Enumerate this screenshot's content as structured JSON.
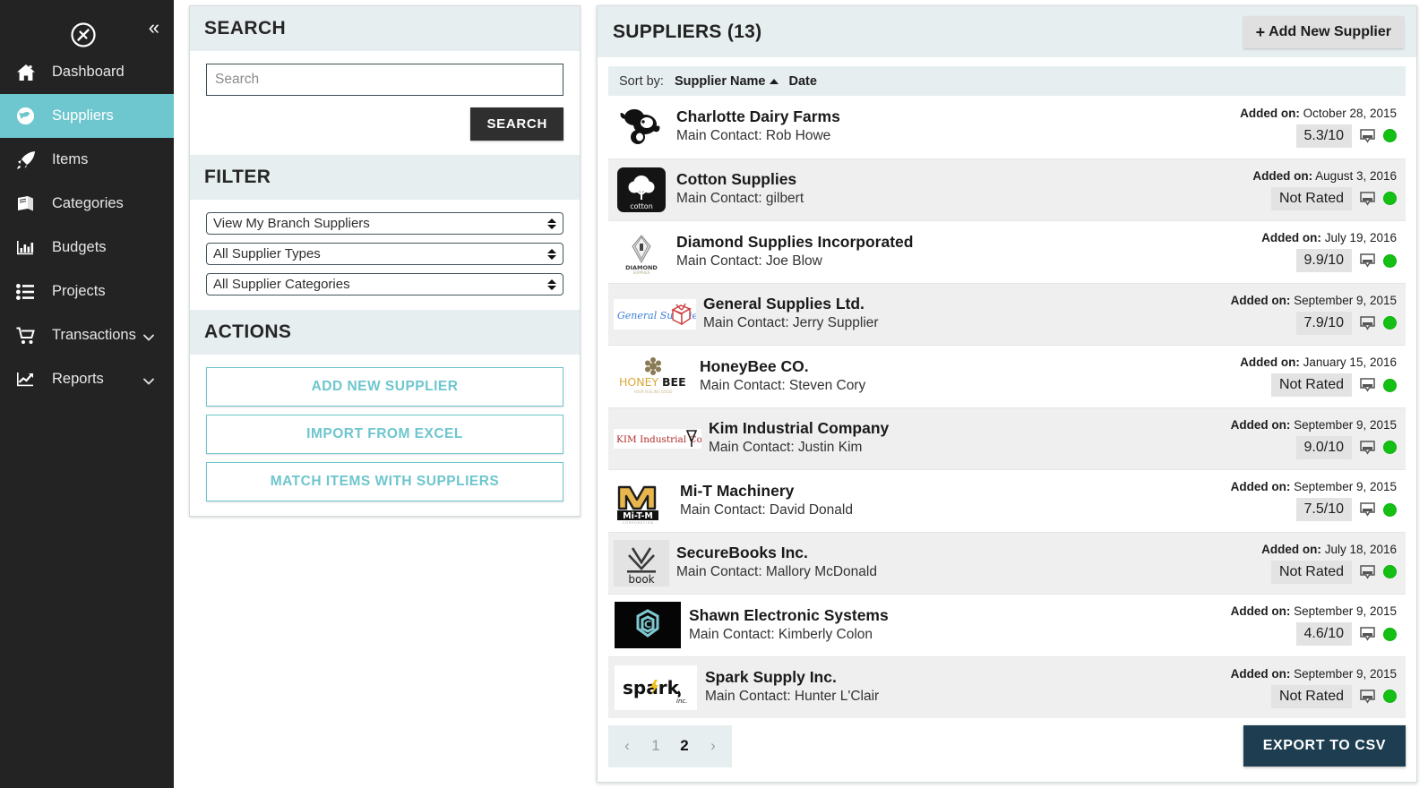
{
  "sidebar": {
    "logo_icon": "circle-slash-logo",
    "collapse_icon": "double-chevron-left-icon",
    "collapse_label": "«",
    "items": [
      {
        "label": "Dashboard",
        "icon": "home-icon",
        "active": false,
        "expandable": false
      },
      {
        "label": "Suppliers",
        "icon": "globe-icon",
        "active": true,
        "expandable": false
      },
      {
        "label": "Items",
        "icon": "rocket-icon",
        "active": false,
        "expandable": false
      },
      {
        "label": "Categories",
        "icon": "book-icon",
        "active": false,
        "expandable": false
      },
      {
        "label": "Budgets",
        "icon": "bar-chart-icon",
        "active": false,
        "expandable": false
      },
      {
        "label": "Projects",
        "icon": "list-icon",
        "active": false,
        "expandable": false
      },
      {
        "label": "Transactions",
        "icon": "shopping-cart-icon",
        "active": false,
        "expandable": true
      },
      {
        "label": "Reports",
        "icon": "line-chart-icon",
        "active": false,
        "expandable": true
      }
    ]
  },
  "search_panel": {
    "title": "SEARCH",
    "input_placeholder": "Search",
    "input_value": "",
    "button_label": "SEARCH"
  },
  "filter_panel": {
    "title": "FILTER",
    "selects": [
      {
        "name": "branch-scope-select",
        "value": "View My Branch Suppliers"
      },
      {
        "name": "supplier-type-select",
        "value": "All Supplier Types"
      },
      {
        "name": "supplier-category-select",
        "value": "All Supplier Categories"
      }
    ]
  },
  "actions_panel": {
    "title": "ACTIONS",
    "buttons": [
      {
        "name": "add-new-supplier-action",
        "label": "ADD NEW SUPPLIER"
      },
      {
        "name": "import-from-excel-action",
        "label": "IMPORT FROM EXCEL"
      },
      {
        "name": "match-items-with-suppliers-action",
        "label": "MATCH ITEMS WITH SUPPLIERS"
      }
    ]
  },
  "suppliers_panel": {
    "title": "SUPPLIERS (13)",
    "add_button_label": "Add New Supplier",
    "add_button_plus": "+",
    "sort": {
      "label": "Sort by:",
      "options": [
        {
          "label": "Supplier Name",
          "active": true,
          "direction": "asc"
        },
        {
          "label": "Date",
          "active": false,
          "direction": ""
        }
      ]
    },
    "added_on_label": "Added on:",
    "contact_prefix": "Main Contact:",
    "rows": [
      {
        "name": "Charlotte Dairy Farms",
        "contact": "Main Contact: Rob Howe",
        "added_on": "October 28, 2015",
        "rating": "5.3/10",
        "logo": "cow-head-logo",
        "shade": "white"
      },
      {
        "name": "Cotton Supplies",
        "contact": "Main Contact: gilbert",
        "added_on": "August 3, 2016",
        "rating": "Not Rated",
        "logo": "cotton-boll-logo",
        "shade": "alt"
      },
      {
        "name": "Diamond Supplies Incorporated",
        "contact": "Main Contact: Joe Blow",
        "added_on": "July 19, 2016",
        "rating": "9.9/10",
        "logo": "diamond-logo",
        "shade": "white"
      },
      {
        "name": "General Supplies Ltd.",
        "contact": "Main Contact: Jerry Supplier",
        "added_on": "September 9, 2015",
        "rating": "7.9/10",
        "logo": "general-supplies-logo",
        "shade": "alt"
      },
      {
        "name": "HoneyBee CO.",
        "contact": "Main Contact: Steven Cory",
        "added_on": "January 15, 2016",
        "rating": "Not Rated",
        "logo": "honeybee-logo",
        "shade": "white"
      },
      {
        "name": "Kim Industrial Company",
        "contact": "Main Contact: Justin Kim",
        "added_on": "September 9, 2015",
        "rating": "9.0/10",
        "logo": "kim-industrial-logo",
        "shade": "alt"
      },
      {
        "name": "Mi-T Machinery",
        "contact": "Main Contact: David Donald",
        "added_on": "September 9, 2015",
        "rating": "7.5/10",
        "logo": "mi-t-m-logo",
        "shade": "white"
      },
      {
        "name": "SecureBooks Inc.",
        "contact": "Main Contact: Mallory McDonald",
        "added_on": "July 18, 2016",
        "rating": "Not Rated",
        "logo": "securebooks-logo",
        "shade": "alt"
      },
      {
        "name": "Shawn Electronic Systems",
        "contact": "Main Contact: Kimberly Colon",
        "added_on": "September 9, 2015",
        "rating": "4.6/10",
        "logo": "shawn-electronics-logo",
        "shade": "white"
      },
      {
        "name": "Spark Supply Inc.",
        "contact": "Main Contact: Hunter L'Clair",
        "added_on": "September 9, 2015",
        "rating": "Not Rated",
        "logo": "spark-logo",
        "shade": "alt"
      }
    ],
    "row_icons": {
      "comment_icon": "comment-bubble-icon",
      "status_icon": "status-dot-active"
    },
    "pagination": {
      "prev_label": "‹",
      "next_label": "›",
      "pages": [
        {
          "label": "1",
          "current": false
        },
        {
          "label": "2",
          "current": true
        }
      ]
    },
    "export_button_label": "EXPORT TO CSV"
  },
  "colors": {
    "sidebar_bg": "#232323",
    "accent_teal": "#6ec6ce",
    "panel_header_bg": "#e7eef0",
    "row_alt_bg": "#efefef",
    "export_btn_bg": "#1e3d51",
    "search_btn_bg": "#2f2f2f",
    "status_green": "#14c014",
    "rating_chip_bg": "#e3e3e3"
  }
}
